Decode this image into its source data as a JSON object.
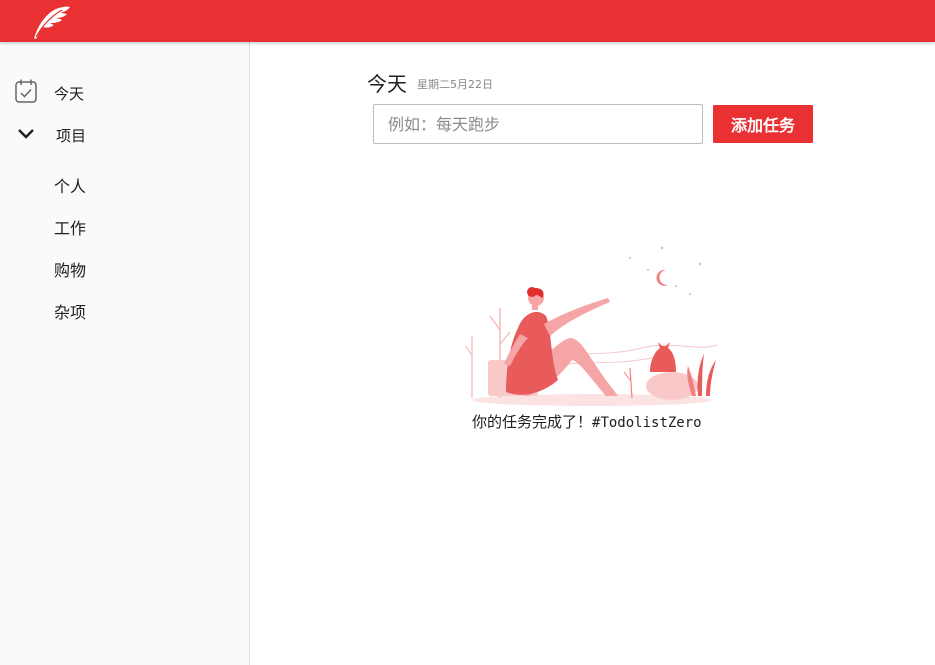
{
  "header": {
    "logo_icon": "feather-icon",
    "color": "#e93032"
  },
  "sidebar": {
    "today": {
      "label": "今天",
      "icon": "calendar-check-icon"
    },
    "projects": {
      "label": "项目",
      "icon": "chevron-down-icon",
      "items": [
        {
          "label": "个人"
        },
        {
          "label": "工作"
        },
        {
          "label": "购物"
        },
        {
          "label": "杂项"
        }
      ]
    }
  },
  "main": {
    "title": "今天",
    "date": "星期二5月22日",
    "input": {
      "placeholder": "例如：每天跑步",
      "value": ""
    },
    "add_button": "添加任务",
    "empty_state": {
      "message": "你的任务完成了！",
      "hashtag": "#TodolistZero",
      "illustration": "woman-sitting-pointing-at-moon-illustration"
    }
  }
}
